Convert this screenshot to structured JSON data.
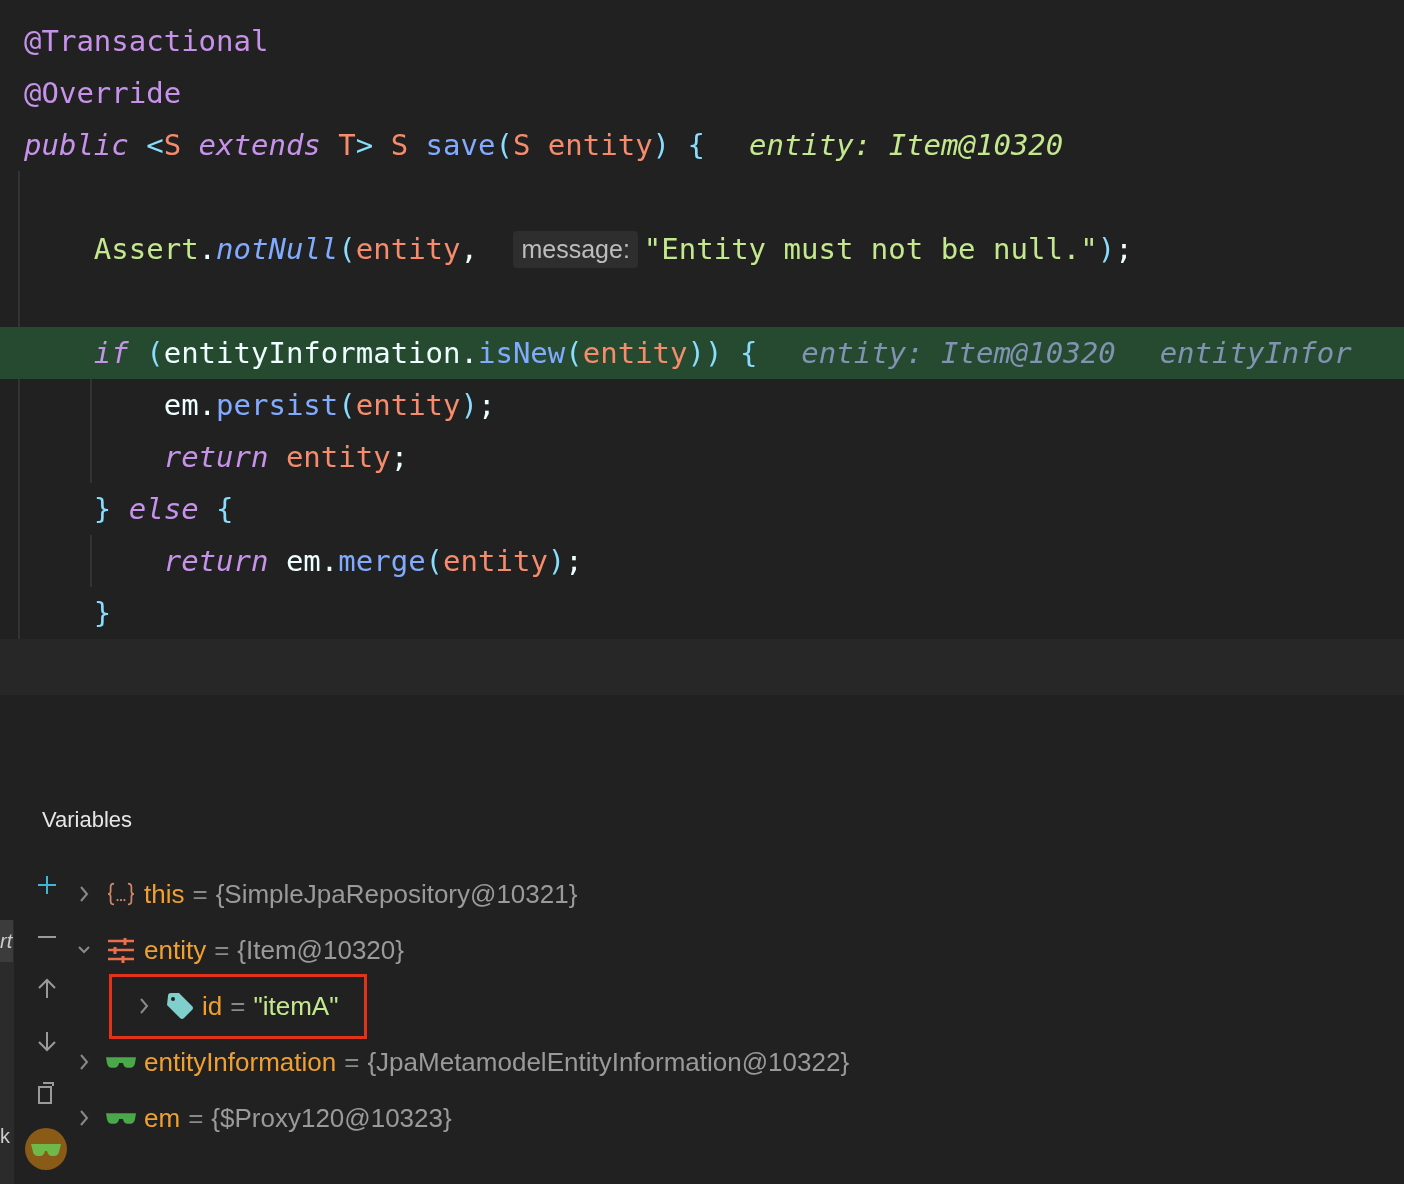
{
  "editor": {
    "lines": [
      {
        "highlighted": false,
        "tokens": [
          {
            "kind": "annotation",
            "text": "@Transactional"
          }
        ]
      },
      {
        "highlighted": false,
        "tokens": [
          {
            "kind": "annotation",
            "text": "@Override"
          }
        ]
      },
      {
        "highlighted": false,
        "tokens": [
          {
            "kind": "keyword",
            "text": "public "
          },
          {
            "kind": "punct",
            "text": "<"
          },
          {
            "kind": "typeparam",
            "text": "S "
          },
          {
            "kind": "keyword",
            "text": "extends "
          },
          {
            "kind": "typeparam",
            "text": "T"
          },
          {
            "kind": "punct",
            "text": "> "
          },
          {
            "kind": "typeparam",
            "text": "S "
          },
          {
            "kind": "method",
            "text": "save"
          },
          {
            "kind": "punct",
            "text": "("
          },
          {
            "kind": "typeparam",
            "text": "S "
          },
          {
            "kind": "param",
            "text": "entity"
          },
          {
            "kind": "punct",
            "text": ") {"
          },
          {
            "kind": "hint",
            "text": "entity: Item@10320"
          }
        ]
      },
      {
        "highlighted": false
      },
      {
        "highlighted": false,
        "tokens": [
          {
            "kind": "class",
            "text": "    Assert"
          },
          {
            "kind": "plain",
            "text": "."
          },
          {
            "kind": "static",
            "text": "notNull"
          },
          {
            "kind": "punct",
            "text": "("
          },
          {
            "kind": "param",
            "text": "entity"
          },
          {
            "kind": "plain",
            "text": ", "
          },
          {
            "kind": "inlay",
            "text": "message:"
          },
          {
            "kind": "string",
            "text": "\"Entity must not be null.\""
          },
          {
            "kind": "punct",
            "text": ")"
          },
          {
            "kind": "plain",
            "text": ";"
          }
        ]
      },
      {
        "highlighted": false
      },
      {
        "highlighted": true,
        "tokens": [
          {
            "kind": "keyword",
            "text": "    if "
          },
          {
            "kind": "punct",
            "text": "("
          },
          {
            "kind": "plain",
            "text": "entityInformation."
          },
          {
            "kind": "method",
            "text": "isNew"
          },
          {
            "kind": "punct",
            "text": "("
          },
          {
            "kind": "param",
            "text": "entity"
          },
          {
            "kind": "punct",
            "text": ")) {"
          },
          {
            "kind": "hint",
            "text": "entity: Item@10320"
          },
          {
            "kind": "hint",
            "text": "entityInfor"
          }
        ]
      },
      {
        "highlighted": false,
        "tokens": [
          {
            "kind": "plain",
            "text": "        em."
          },
          {
            "kind": "method",
            "text": "persist"
          },
          {
            "kind": "punct",
            "text": "("
          },
          {
            "kind": "param",
            "text": "entity"
          },
          {
            "kind": "punct",
            "text": ")"
          },
          {
            "kind": "plain",
            "text": ";"
          }
        ]
      },
      {
        "highlighted": false,
        "tokens": [
          {
            "kind": "keyword",
            "text": "        return "
          },
          {
            "kind": "param",
            "text": "entity"
          },
          {
            "kind": "plain",
            "text": ";"
          }
        ]
      },
      {
        "highlighted": false,
        "tokens": [
          {
            "kind": "punct",
            "text": "    } "
          },
          {
            "kind": "keyword",
            "text": "else "
          },
          {
            "kind": "punct",
            "text": "{"
          }
        ]
      },
      {
        "highlighted": false,
        "tokens": [
          {
            "kind": "keyword",
            "text": "        return "
          },
          {
            "kind": "plain",
            "text": "em."
          },
          {
            "kind": "method",
            "text": "merge"
          },
          {
            "kind": "punct",
            "text": "("
          },
          {
            "kind": "param",
            "text": "entity"
          },
          {
            "kind": "punct",
            "text": ")"
          },
          {
            "kind": "plain",
            "text": ";"
          }
        ]
      },
      {
        "highlighted": false,
        "tokens": [
          {
            "kind": "punct",
            "text": "    }"
          }
        ]
      }
    ]
  },
  "edge_fragments": [
    "rt",
    "k"
  ],
  "variables": {
    "title": "Variables",
    "nodes": [
      {
        "kind": "this",
        "name": "this",
        "operator": "=",
        "value": "{SimpleJpaRepository@10321}",
        "expanded": false,
        "boxed": false
      },
      {
        "kind": "instance",
        "name": "entity",
        "operator": "=",
        "value": "{Item@10320}",
        "expanded": true,
        "boxed": false,
        "children": [
          {
            "kind": "string",
            "name": "id",
            "operator": "=",
            "value": "\"itemA\"",
            "expanded": false,
            "boxed": true
          }
        ]
      },
      {
        "kind": "watch",
        "name": "entityInformation",
        "operator": "=",
        "value": "{JpaMetamodelEntityInformation@10322}",
        "expanded": false,
        "boxed": false
      },
      {
        "kind": "watch",
        "name": "em",
        "operator": "=",
        "value": "{$Proxy120@10323}",
        "expanded": false,
        "boxed": false
      }
    ]
  }
}
